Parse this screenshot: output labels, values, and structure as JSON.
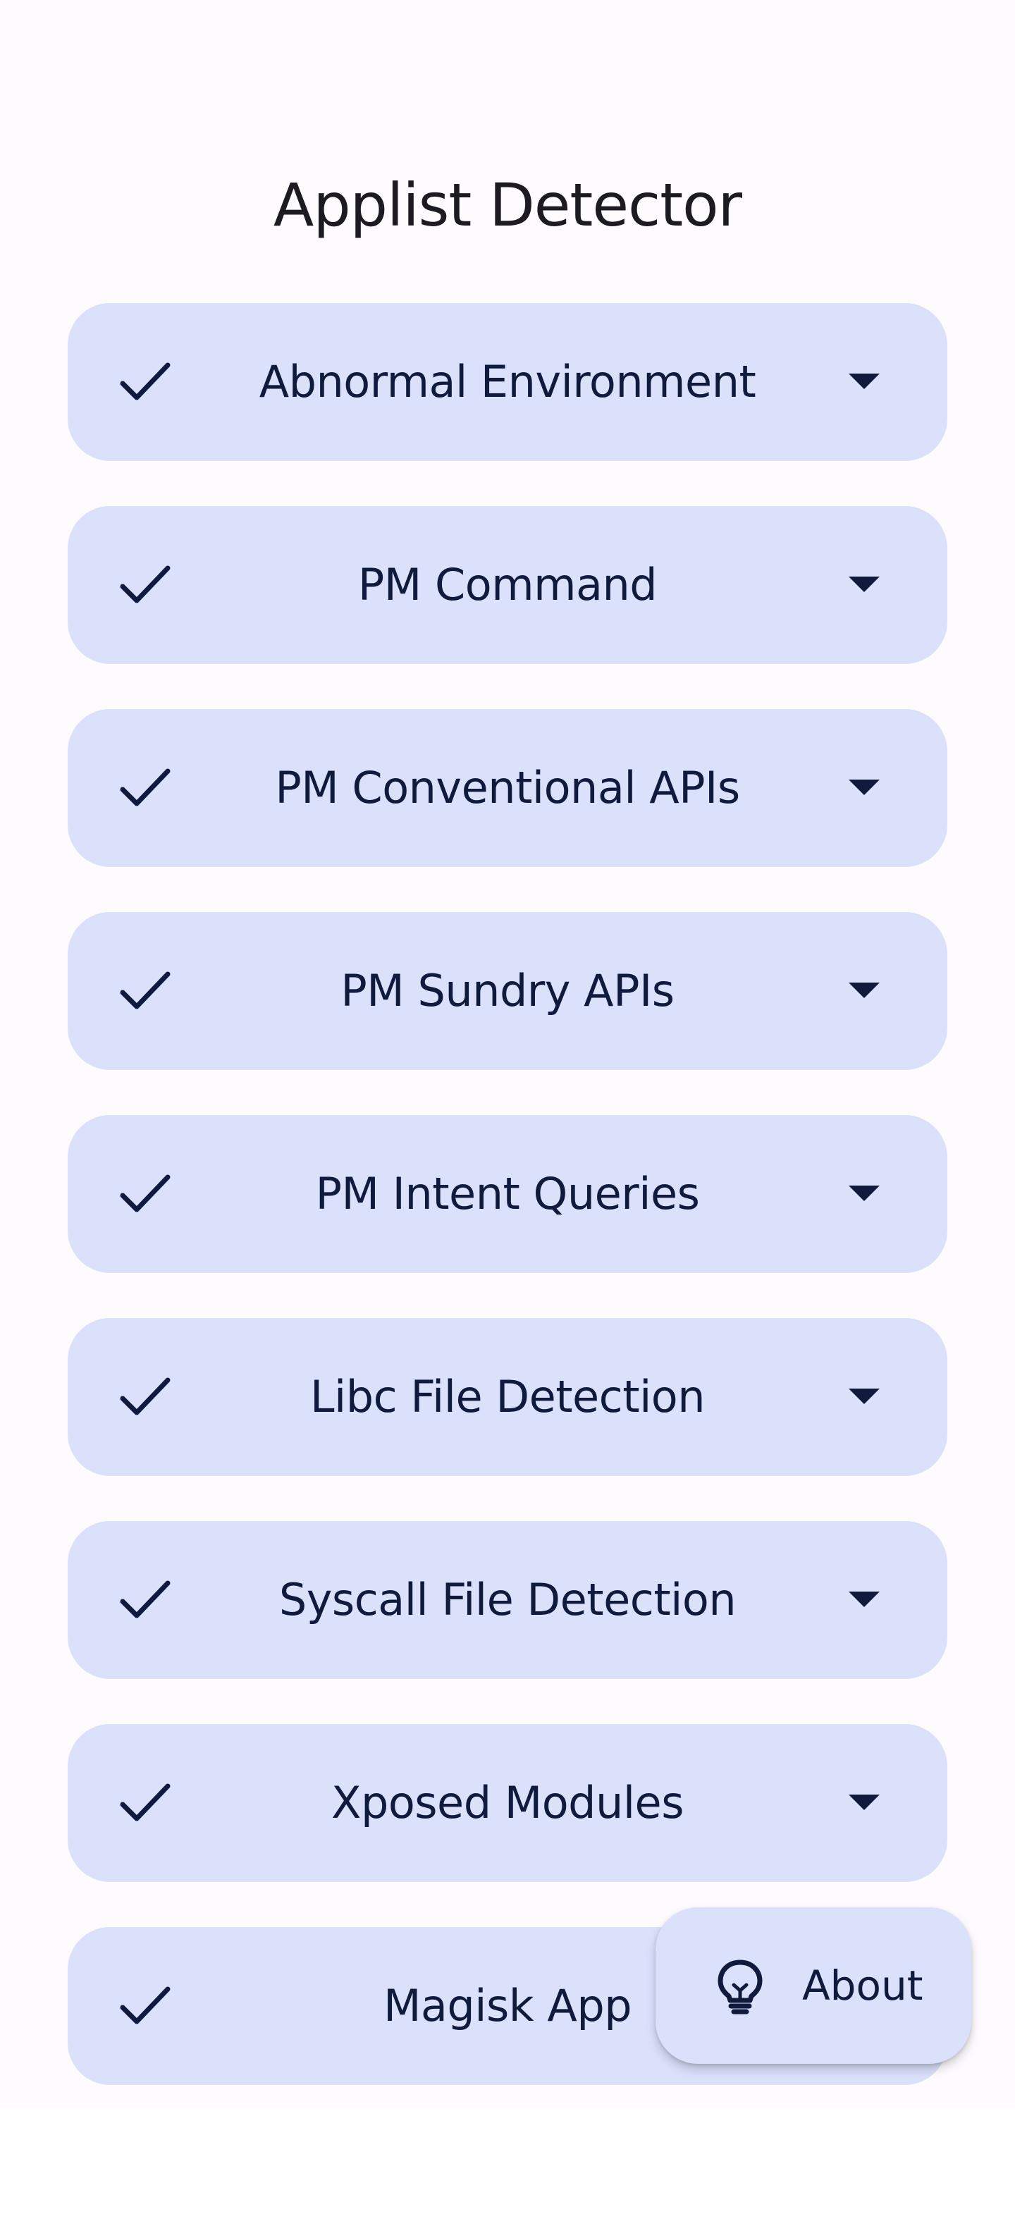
{
  "app": {
    "title": "Applist Detector"
  },
  "detections": [
    {
      "label": "Abnormal Environment",
      "status_icon": "check-icon",
      "expand_icon": "caret-down-icon"
    },
    {
      "label": "PM Command",
      "status_icon": "check-icon",
      "expand_icon": "caret-down-icon"
    },
    {
      "label": "PM Conventional APIs",
      "status_icon": "check-icon",
      "expand_icon": "caret-down-icon"
    },
    {
      "label": "PM Sundry APIs",
      "status_icon": "check-icon",
      "expand_icon": "caret-down-icon"
    },
    {
      "label": "PM Intent Queries",
      "status_icon": "check-icon",
      "expand_icon": "caret-down-icon"
    },
    {
      "label": "Libc File Detection",
      "status_icon": "check-icon",
      "expand_icon": "caret-down-icon"
    },
    {
      "label": "Syscall File Detection",
      "status_icon": "check-icon",
      "expand_icon": "caret-down-icon"
    },
    {
      "label": "Xposed Modules",
      "status_icon": "check-icon",
      "expand_icon": "caret-down-icon"
    },
    {
      "label": "Magisk App",
      "status_icon": "check-icon",
      "expand_icon": "caret-down-icon"
    }
  ],
  "fab": {
    "label": "About",
    "icon": "lightbulb-icon"
  },
  "colors": {
    "background": "#fefbff",
    "card": "#dbe0fb",
    "on_card": "#0f1a3d",
    "title": "#1b1b21"
  }
}
